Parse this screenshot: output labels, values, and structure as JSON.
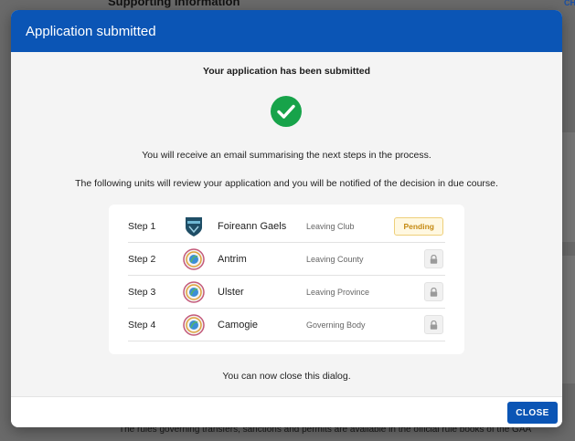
{
  "background": {
    "section_heading": "Supporting information",
    "top_right_link": "CH",
    "footer_text": "The rules governing transfers, sanctions and permits are available in the official rule books of the GAA"
  },
  "dialog": {
    "title": "Application submitted",
    "heading": "Your application has been submitted",
    "email_message": "You will receive an email summarising the next steps in the process.",
    "review_message": "The following units will review your application and you will be notified of the decision in due course.",
    "steps": [
      {
        "step": "Step 1",
        "unit": "Foireann Gaels",
        "role": "Leaving Club",
        "status": "Pending",
        "crest": "club-crest-icon"
      },
      {
        "step": "Step 2",
        "unit": "Antrim",
        "role": "Leaving County",
        "status": "locked",
        "crest": "camogie-crest-icon"
      },
      {
        "step": "Step 3",
        "unit": "Ulster",
        "role": "Leaving Province",
        "status": "locked",
        "crest": "camogie-crest-icon"
      },
      {
        "step": "Step 4",
        "unit": "Camogie",
        "role": "Governing Body",
        "status": "locked",
        "crest": "camogie-crest-icon"
      }
    ],
    "close_note": "You can now close this dialog.",
    "close_button": "CLOSE"
  },
  "colors": {
    "header_blue": "#0b55b5",
    "success_green": "#17a34a",
    "pending_amber": "#c58a12"
  }
}
